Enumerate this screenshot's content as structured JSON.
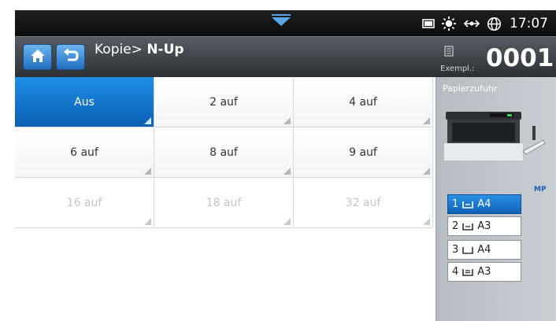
{
  "statusbar": {
    "time": "17:07",
    "icons": [
      "toner-icon",
      "eco-sun-icon",
      "network-icon",
      "globe-icon"
    ]
  },
  "header": {
    "home_icon": "home-icon",
    "back_icon": "back-arrow-icon",
    "breadcrumb": "Kopie> ",
    "title": "N-Up",
    "copies_label": "Exempl.:",
    "copies_value": "0001"
  },
  "options": [
    {
      "label": "Aus",
      "state": "selected"
    },
    {
      "label": "2 auf",
      "state": "normal"
    },
    {
      "label": "4 auf",
      "state": "normal"
    },
    {
      "label": "6 auf",
      "state": "normal"
    },
    {
      "label": "8 auf",
      "state": "normal"
    },
    {
      "label": "9 auf",
      "state": "normal"
    },
    {
      "label": "16 auf",
      "state": "disabled"
    },
    {
      "label": "18 auf",
      "state": "disabled"
    },
    {
      "label": "32 auf",
      "state": "disabled"
    }
  ],
  "paper": {
    "title": "Papierzufuhr",
    "mp_label": "MP",
    "trays": [
      {
        "label": "1",
        "size": "A4",
        "selected": true
      },
      {
        "label": "2",
        "size": "A3",
        "selected": false
      },
      {
        "label": "3",
        "size": "A4",
        "selected": false
      },
      {
        "label": "4",
        "size": "A3",
        "selected": false
      }
    ]
  },
  "colors": {
    "accent": "#1677d2",
    "header_bg": "#3f454b",
    "statusbar_bg": "#111213"
  }
}
